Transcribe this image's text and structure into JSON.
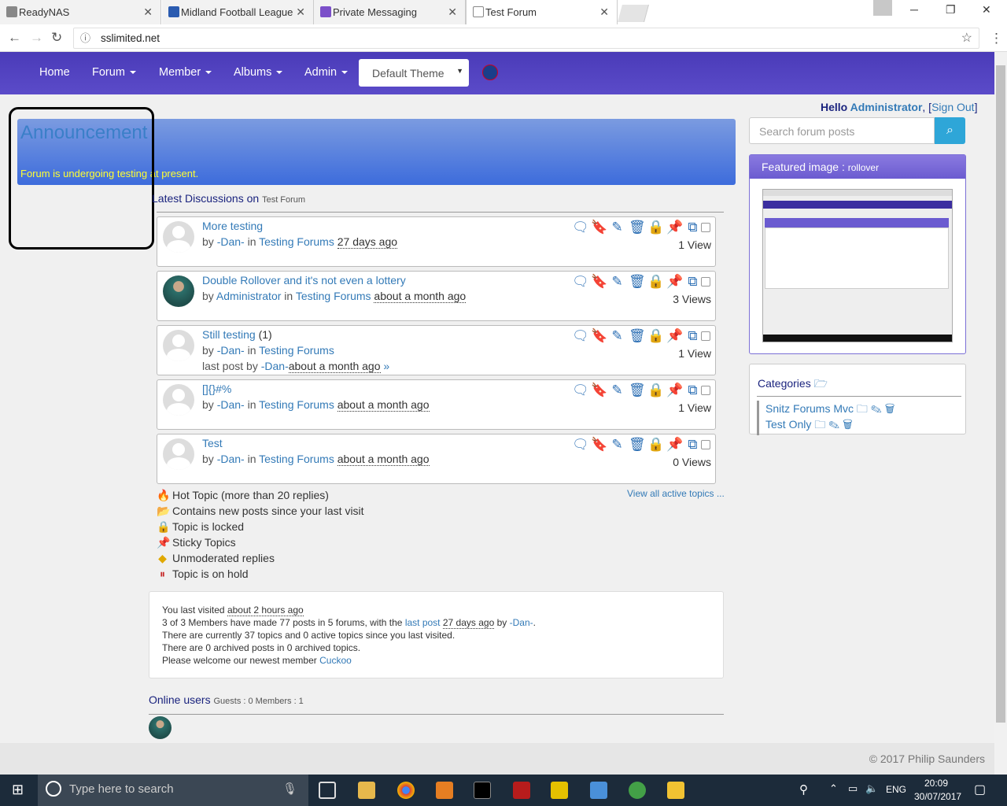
{
  "browser": {
    "tabs": [
      {
        "label": "ReadyNAS"
      },
      {
        "label": "Midland Football League"
      },
      {
        "label": "Private Messaging"
      },
      {
        "label": "Test Forum"
      }
    ],
    "url": "sslimited.net"
  },
  "nav": {
    "home": "Home",
    "forum": "Forum",
    "member": "Member",
    "albums": "Albums",
    "admin": "Admin",
    "theme": "Default Theme"
  },
  "user": {
    "hello": "Hello",
    "name": "Administrator",
    "signout_open": ", [",
    "signout": "Sign Out",
    "signout_close": "]"
  },
  "search": {
    "placeholder": "Search forum posts"
  },
  "announcement": {
    "title": "Announcement",
    "text": "Forum is undergoing testing at present."
  },
  "discussions": {
    "heading": "Latest Discussions on",
    "forum": "Test Forum"
  },
  "topics": [
    {
      "title": "More testing",
      "author": "-Dan-",
      "forum": "Testing Forums",
      "ago": "27 days ago",
      "views": "1 View",
      "avatar": "ghost"
    },
    {
      "title": "Double Rollover and it's not even a lottery",
      "author": "Administrator",
      "forum": "Testing Forums",
      "ago": "about a month ago",
      "views": "3 Views",
      "avatar": "admin"
    },
    {
      "title": "Still testing",
      "count": "(1)",
      "author": "-Dan-",
      "forum": "Testing Forums",
      "ago": "",
      "last_by": "-Dan-",
      "last_ago": "about a month ago",
      "views": "1 View",
      "avatar": "ghost"
    },
    {
      "title": "[]{}#%",
      "author": "-Dan-",
      "forum": "Testing Forums",
      "ago": "about a month ago",
      "views": "1 View",
      "avatar": "ghost"
    },
    {
      "title": "Test",
      "author": "-Dan-",
      "forum": "Testing Forums",
      "ago": "about a month ago",
      "views": "0 Views",
      "avatar": "ghost"
    }
  ],
  "topic_labels": {
    "by": "by",
    "in": "in",
    "last_post": "last post by"
  },
  "view_all": "View all active topics ...",
  "legend": [
    {
      "icon": "hot-icon",
      "glyph": "🔥",
      "label": "Hot Topic (more than 20 replies)"
    },
    {
      "icon": "new-posts-icon",
      "glyph": "📂",
      "label": "Contains new posts since your last visit"
    },
    {
      "icon": "locked-icon",
      "glyph": "🔒",
      "label": "Topic is locked"
    },
    {
      "icon": "sticky-icon",
      "glyph": "📌",
      "label": "Sticky Topics"
    },
    {
      "icon": "unmoderated-icon",
      "glyph": "◆",
      "label": "Unmoderated replies"
    },
    {
      "icon": "hold-icon",
      "glyph": "⏸",
      "label": "Topic is on hold"
    }
  ],
  "stats": {
    "visited_label": "You last visited",
    "visited": "about 2 hours ago",
    "members_a": "3 of 3 Members have made 77 posts in 5 forums, with the",
    "last_post": "last post",
    "last_ago": "27 days ago",
    "by": "by",
    "last_by": "-Dan-",
    "topics": "There are currently 37 topics and 0 active topics since you last visited.",
    "archived": "There are 0 archived posts in 0 archived topics.",
    "welcome": "Please welcome our newest member",
    "newest": "Cuckoo"
  },
  "online": {
    "label": "Online users",
    "counts": "Guests : 0 Members : 1"
  },
  "footer": "© 2017 Philip Saunders",
  "featured": {
    "label": "Featured image :",
    "name": "rollover"
  },
  "categories": {
    "heading": "Categories",
    "items": [
      {
        "label": "Snitz Forums Mvc"
      },
      {
        "label": "Test Only"
      }
    ]
  },
  "taskbar": {
    "search": "Type here to search",
    "lang": "ENG",
    "time": "20:09",
    "date": "30/07/2017"
  }
}
